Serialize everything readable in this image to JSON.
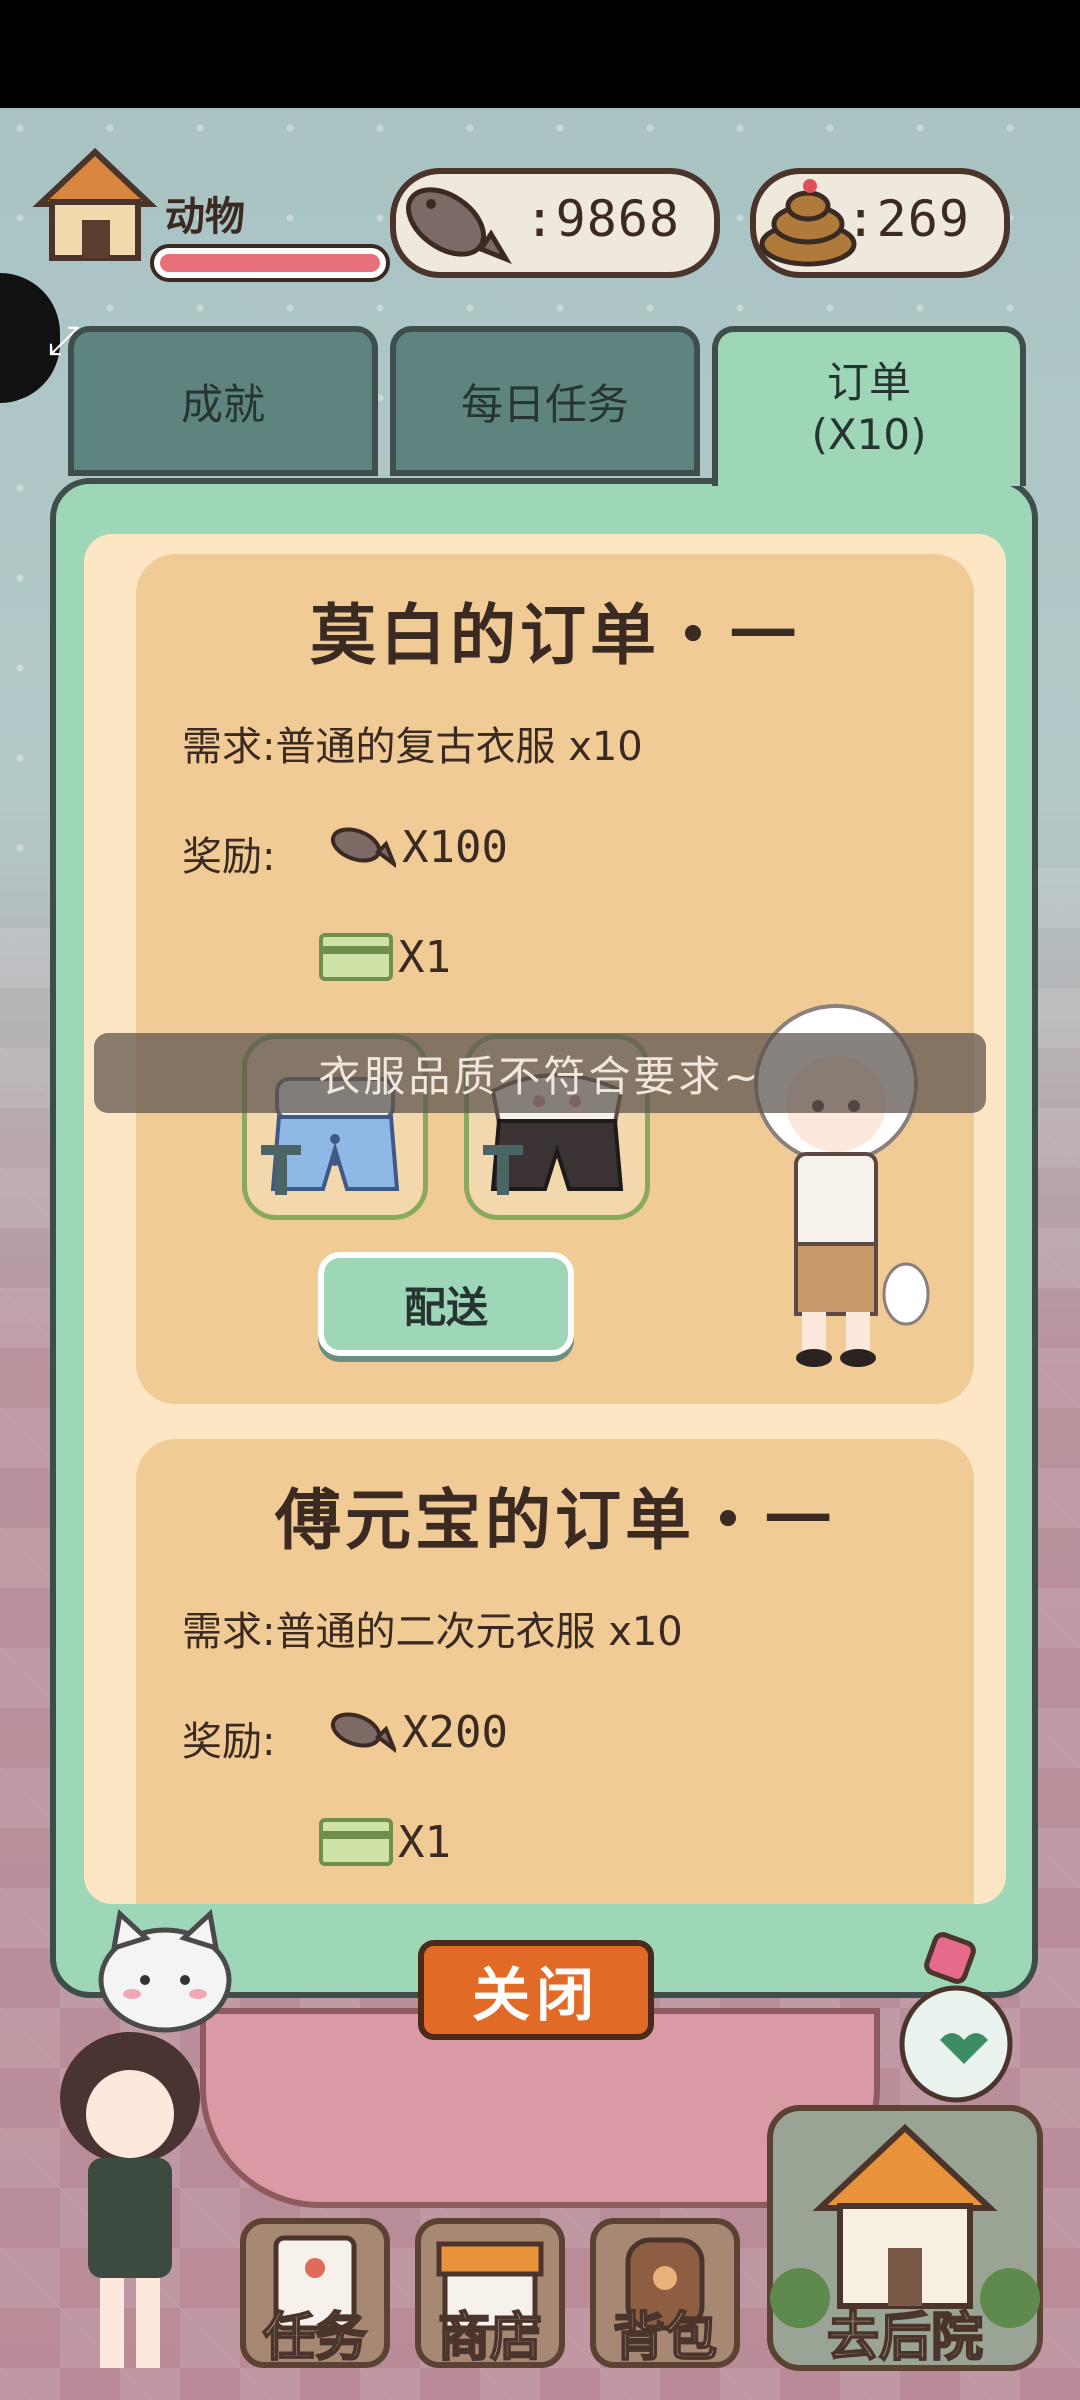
{
  "hud": {
    "name": "动物",
    "health_fraction": 1.0,
    "fish_count": ":9868",
    "poop_count": ":269"
  },
  "tabs": [
    {
      "label": "成就"
    },
    {
      "label": "每日任务"
    },
    {
      "label": "订单",
      "sub": "(X10)"
    }
  ],
  "orders": [
    {
      "title": "莫白的订单・一",
      "requirement": "需求:普通的复古衣服 x10",
      "reward_label": "奖励:",
      "fish_reward": "X100",
      "card_reward": "X1",
      "deliver_label": "配送"
    },
    {
      "title": "傅元宝的订单・一",
      "requirement": "需求:普通的二次元衣服 x10",
      "reward_label": "奖励:",
      "fish_reward": "X200",
      "card_reward": "X1"
    }
  ],
  "toast": "衣服品质不符合要求~",
  "close_label": "关闭",
  "nav": {
    "task": "任务",
    "shop": "商店",
    "bag": "背包",
    "yard": "去后院"
  },
  "colors": {
    "panel_green": "#9ed7b8",
    "card_tan": "#f0cb96",
    "close_orange": "#e06a26",
    "health_red": "#e8707a"
  }
}
